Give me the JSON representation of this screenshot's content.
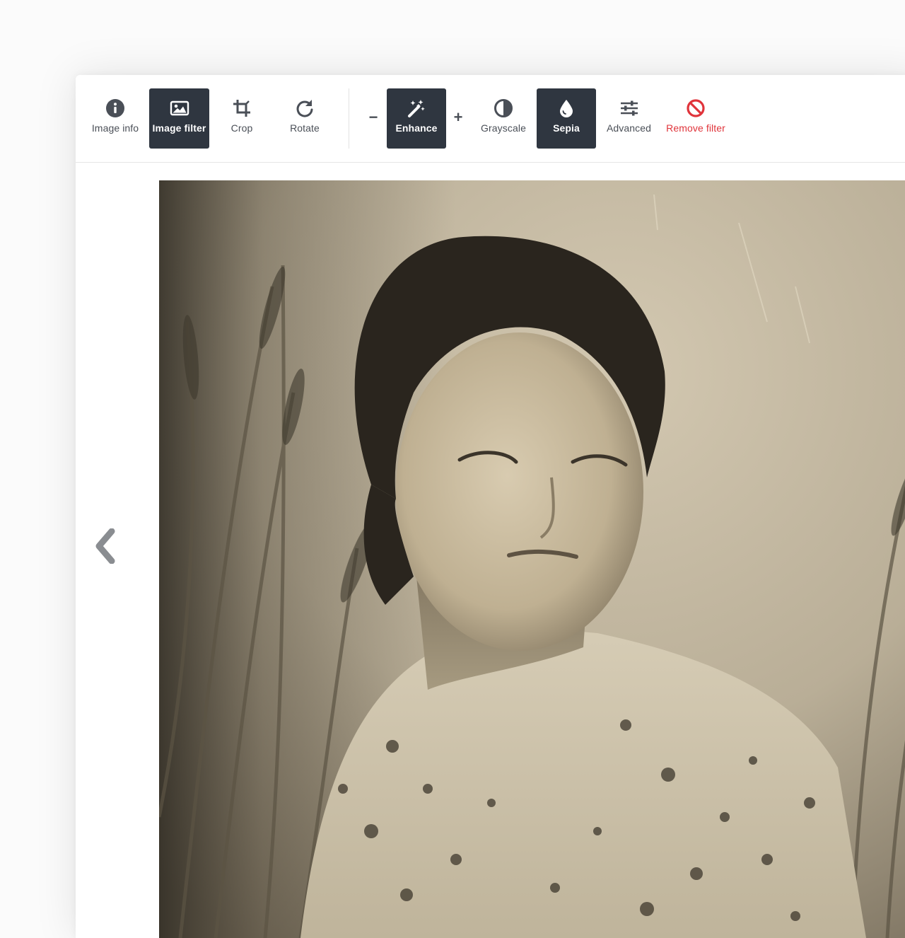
{
  "toolbar": {
    "tools": [
      {
        "label": "Image info",
        "icon": "info-icon",
        "active": false
      },
      {
        "label": "Image filter",
        "icon": "image-icon",
        "active": true
      },
      {
        "label": "Crop",
        "icon": "crop-icon",
        "active": false
      },
      {
        "label": "Rotate",
        "icon": "rotate-icon",
        "active": false
      }
    ],
    "filters": [
      {
        "label": "Enhance",
        "icon": "magic-wand-icon",
        "active": true
      },
      {
        "label": "Grayscale",
        "icon": "contrast-icon",
        "active": false
      },
      {
        "label": "Sepia",
        "icon": "droplet-icon",
        "active": true
      },
      {
        "label": "Advanced",
        "icon": "sliders-icon",
        "active": false
      },
      {
        "label": "Remove filter",
        "icon": "ban-icon",
        "active": false
      }
    ],
    "enhance_decrease": "−",
    "enhance_increase": "+"
  },
  "viewer": {
    "prev_icon": "chevron-left-icon",
    "image_alt": "Sepia-toned vintage photograph"
  },
  "colors": {
    "active_bg": "#2f3640",
    "danger": "#e0343b",
    "text": "#4a4f57"
  }
}
